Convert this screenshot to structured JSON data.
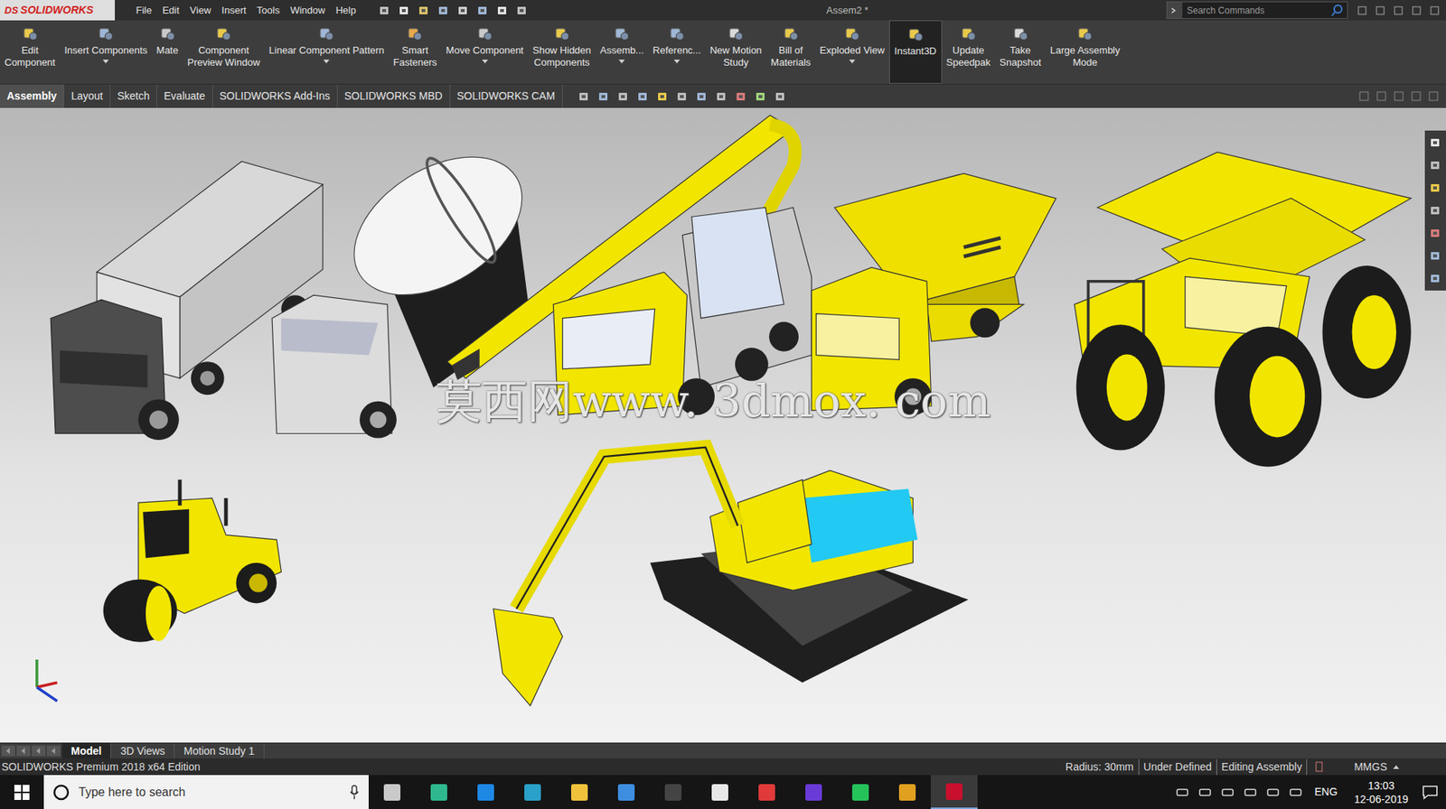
{
  "app": {
    "logo_mark": "DS",
    "name": "SOLIDWORKS"
  },
  "menu": [
    "File",
    "Edit",
    "View",
    "Insert",
    "Tools",
    "Window",
    "Help"
  ],
  "window": {
    "title": "Assem2 *"
  },
  "search": {
    "placeholder": "Search Commands"
  },
  "toolbar": [
    {
      "lines": [
        "Edit",
        "Component"
      ],
      "dropdown": false,
      "selected": false
    },
    {
      "lines": [
        "Insert Components"
      ],
      "dropdown": true,
      "selected": false
    },
    {
      "lines": [
        "Mate"
      ],
      "dropdown": false,
      "selected": false
    },
    {
      "lines": [
        "Component",
        "Preview Window"
      ],
      "dropdown": false,
      "selected": false
    },
    {
      "lines": [
        "Linear Component Pattern"
      ],
      "dropdown": true,
      "selected": false
    },
    {
      "lines": [
        "Smart",
        "Fasteners"
      ],
      "dropdown": false,
      "selected": false
    },
    {
      "lines": [
        "Move Component"
      ],
      "dropdown": true,
      "selected": false
    },
    {
      "lines": [
        "Show Hidden",
        "Components"
      ],
      "dropdown": false,
      "selected": false
    },
    {
      "lines": [
        "Assemb..."
      ],
      "dropdown": true,
      "selected": false
    },
    {
      "lines": [
        "Referenc..."
      ],
      "dropdown": true,
      "selected": false
    },
    {
      "lines": [
        "New Motion",
        "Study"
      ],
      "dropdown": false,
      "selected": false
    },
    {
      "lines": [
        "Bill of",
        "Materials"
      ],
      "dropdown": false,
      "selected": false
    },
    {
      "lines": [
        "Exploded View"
      ],
      "dropdown": true,
      "selected": false
    },
    {
      "lines": [
        "Instant3D"
      ],
      "dropdown": false,
      "selected": true
    },
    {
      "lines": [
        "Update",
        "Speedpak"
      ],
      "dropdown": false,
      "selected": false
    },
    {
      "lines": [
        "Take",
        "Snapshot"
      ],
      "dropdown": false,
      "selected": false
    },
    {
      "lines": [
        "Large Assembly",
        "Mode"
      ],
      "dropdown": false,
      "selected": false
    }
  ],
  "tabs": [
    {
      "label": "Assembly",
      "selected": true
    },
    {
      "label": "Layout",
      "selected": false
    },
    {
      "label": "Sketch",
      "selected": false
    },
    {
      "label": "Evaluate",
      "selected": false
    },
    {
      "label": "SOLIDWORKS Add-Ins",
      "selected": false
    },
    {
      "label": "SOLIDWORKS MBD",
      "selected": false
    },
    {
      "label": "SOLIDWORKS CAM",
      "selected": false
    }
  ],
  "viewport": {
    "watermark": "莫西网www. 3dmox. com"
  },
  "bottom_tabs": [
    {
      "label": "Model",
      "selected": true
    },
    {
      "label": "3D Views",
      "selected": false
    },
    {
      "label": "Motion Study 1",
      "selected": false
    }
  ],
  "status_bar": {
    "edition": "SOLIDWORKS Premium 2018 x64 Edition",
    "items": [
      "Radius: 30mm",
      "Under Defined",
      "Editing Assembly"
    ],
    "units": "MMGS"
  },
  "taskbar": {
    "search_placeholder": "Type here to search",
    "language": "ENG",
    "time": "13:03",
    "date": "12-06-2019"
  }
}
